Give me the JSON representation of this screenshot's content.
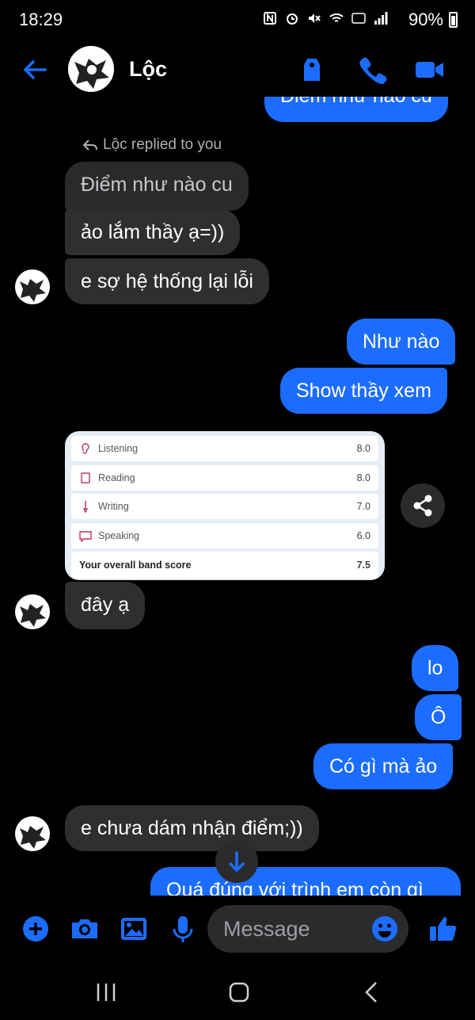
{
  "status": {
    "time": "18:29",
    "battery": "90%"
  },
  "header": {
    "contact_name": "Lộc"
  },
  "chat": {
    "partial_top": "Điểm như nào cu",
    "reply_note": "Lộc replied to you",
    "quoted": "Điểm như nào cu",
    "m1": "ảo lắm thầy ạ=))",
    "m2": "e sợ hệ thống lại lỗi",
    "m3": "Như nào",
    "m4": "Show thầy xem",
    "score_card": {
      "rows": [
        {
          "label": "Listening",
          "value": "8.0"
        },
        {
          "label": "Reading",
          "value": "8.0"
        },
        {
          "label": "Writing",
          "value": "7.0"
        },
        {
          "label": "Speaking",
          "value": "6.0"
        }
      ],
      "total_label": "Your overall band score",
      "total_value": "7.5"
    },
    "m5": "đây ạ",
    "m6": "lo",
    "m7": "Ô",
    "m8": "Có gì mà ảo",
    "m9": "e chưa dám nhận điểm;))",
    "m10_partial": "Quá đúng với trình em còn gì"
  },
  "composer": {
    "placeholder": "Message"
  },
  "colors": {
    "accent": "#1c6dff",
    "incoming": "#2f2f31",
    "background": "#000000"
  }
}
